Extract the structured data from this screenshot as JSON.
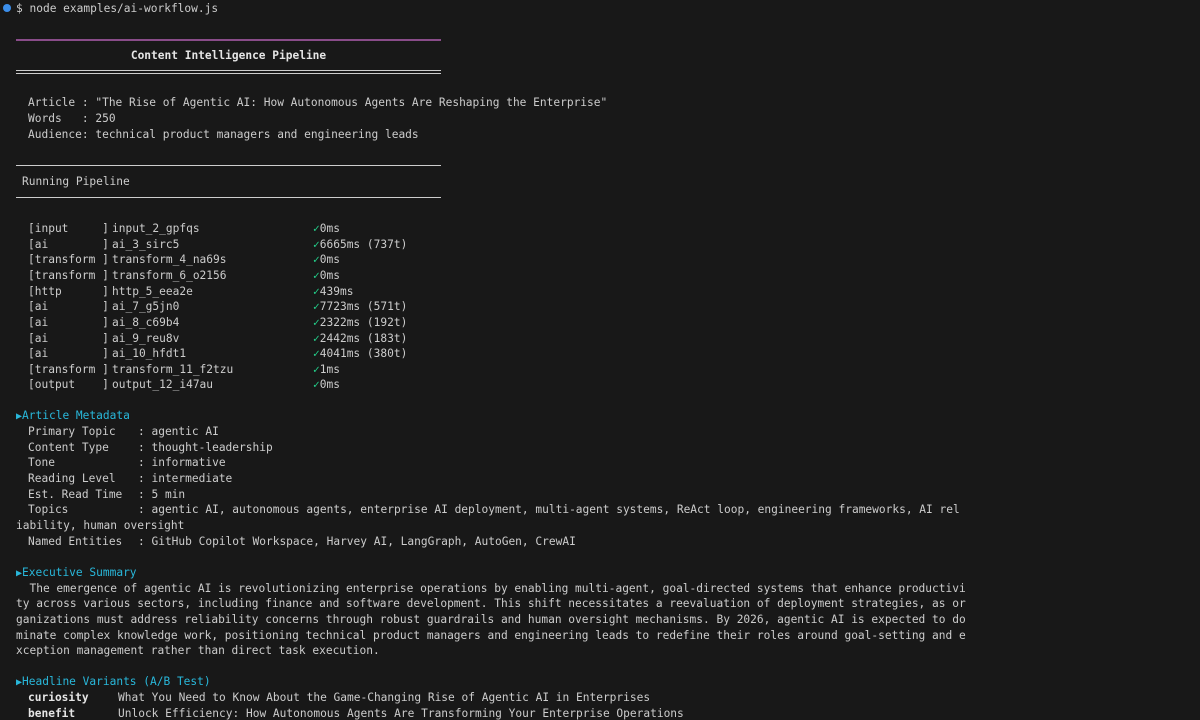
{
  "command": {
    "prompt": "$",
    "text": "node examples/ai-workflow.js"
  },
  "banner": {
    "title": "Content Intelligence Pipeline"
  },
  "article": {
    "lines": [
      "Article : \"The Rise of Agentic AI: How Autonomous Agents Are Reshaping the Enterprise\"",
      "Words   : 250",
      "Audience: technical product managers and engineering leads"
    ]
  },
  "pipeline": {
    "heading": "Running Pipeline",
    "steps": [
      {
        "type": "[input     ]",
        "id": "input_2_gpfqs",
        "check": "✓",
        "status": "0ms"
      },
      {
        "type": "[ai        ]",
        "id": "ai_3_sirc5",
        "check": "✓",
        "status": "6665ms (737t)"
      },
      {
        "type": "[transform ]",
        "id": "transform_4_na69s",
        "check": "✓",
        "status": "0ms"
      },
      {
        "type": "[transform ]",
        "id": "transform_6_o2156",
        "check": "✓",
        "status": "0ms"
      },
      {
        "type": "[http      ]",
        "id": "http_5_eea2e",
        "check": "✓",
        "status": "439ms"
      },
      {
        "type": "[ai        ]",
        "id": "ai_7_g5jn0",
        "check": "✓",
        "status": "7723ms (571t)"
      },
      {
        "type": "[ai        ]",
        "id": "ai_8_c69b4",
        "check": "✓",
        "status": "2322ms (192t)"
      },
      {
        "type": "[ai        ]",
        "id": "ai_9_reu8v",
        "check": "✓",
        "status": "2442ms (183t)"
      },
      {
        "type": "[ai        ]",
        "id": "ai_10_hfdt1",
        "check": "✓",
        "status": "4041ms (380t)"
      },
      {
        "type": "[transform ]",
        "id": "transform_11_f2tzu",
        "check": "✓",
        "status": "1ms"
      },
      {
        "type": "[output    ]",
        "id": "output_12_i47au",
        "check": "✓",
        "status": "0ms"
      }
    ]
  },
  "metadata": {
    "heading": "Article Metadata",
    "fields": [
      {
        "key": "Primary Topic",
        "val": ": agentic AI"
      },
      {
        "key": "Content Type",
        "val": ": thought-leadership"
      },
      {
        "key": "Tone",
        "val": ": informative"
      },
      {
        "key": "Reading Level",
        "val": ": intermediate"
      },
      {
        "key": "Est. Read Time",
        "val": ": 5 min"
      },
      {
        "key": "Topics",
        "val": ": agentic AI, autonomous agents, enterprise AI deployment, multi-agent systems, ReAct loop, engineering frameworks, AI rel"
      },
      {
        "key": "",
        "val": "iability, human oversight",
        "wrap": true
      },
      {
        "key": "Named Entities",
        "val": ": GitHub Copilot Workspace, Harvey AI, LangGraph, AutoGen, CrewAI"
      }
    ]
  },
  "summary": {
    "heading": "Executive Summary",
    "lines": [
      "  The emergence of agentic AI is revolutionizing enterprise operations by enabling multi-agent, goal-directed systems that enhance productivi",
      "ty across various sectors, including finance and software development. This shift necessitates a reevaluation of deployment strategies, as or",
      "ganizations must address reliability concerns through robust guardrails and human oversight mechanisms. By 2026, agentic AI is expected to do",
      "minate complex knowledge work, positioning technical product managers and engineering leads to redefine their roles around goal-setting and e",
      "xception management rather than direct task execution."
    ]
  },
  "headlines": {
    "heading": "Headline Variants (A/B Test)",
    "variants": [
      {
        "key": "curiosity",
        "val": "What You Need to Know About the Game-Changing Rise of Agentic AI in Enterprises"
      },
      {
        "key": "benefit",
        "val": "Unlock Efficiency: How Autonomous Agents Are Transforming Your Enterprise Operations"
      }
    ]
  },
  "colors": {
    "background": "#181818",
    "text": "#cccccc",
    "accent_cyan": "#29b8db",
    "check_green": "#23d18b",
    "banner_pink": "#d670d6"
  }
}
